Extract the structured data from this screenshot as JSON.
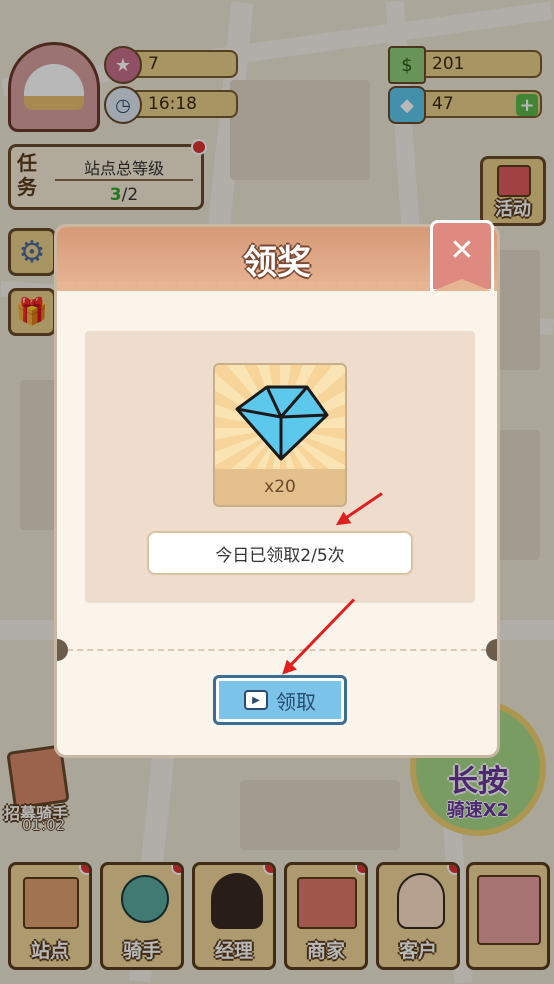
{
  "hud": {
    "level": "7",
    "time": "16:18",
    "cash": "201",
    "diamonds": "47"
  },
  "task": {
    "label": "任务",
    "title": "站点总等级",
    "progress_current": "3",
    "progress_total": "/2"
  },
  "activity_label": "活动",
  "modal": {
    "title": "领奖",
    "reward_qty": "x20",
    "daily_count": "今日已领取2/5次",
    "claim_label": "领取"
  },
  "side": {
    "recruit_label": "招募骑手",
    "recruit_timer": "01:02",
    "longpress_label": "长按",
    "speed_label": "骑速X2"
  },
  "nav": {
    "items": [
      {
        "label": "站点"
      },
      {
        "label": "骑手"
      },
      {
        "label": "经理"
      },
      {
        "label": "商家"
      },
      {
        "label": "客户"
      }
    ]
  },
  "colors": {
    "modal_header": "#d69a78",
    "claim_button": "#7cc3ea",
    "annotation_arrow": "#e02020",
    "diamond": "#5cc8ec"
  }
}
